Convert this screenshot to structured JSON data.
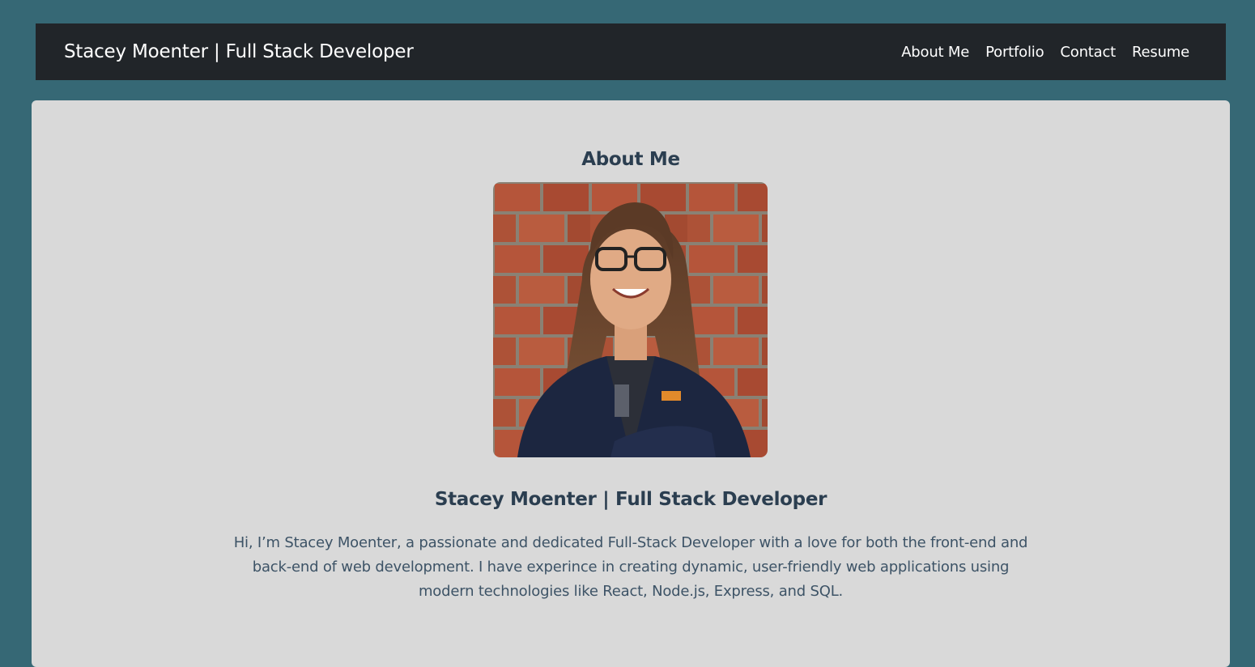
{
  "header": {
    "brand": "Stacey Moenter | Full Stack Developer",
    "nav": [
      {
        "label": "About Me"
      },
      {
        "label": "Portfolio"
      },
      {
        "label": "Contact"
      },
      {
        "label": "Resume"
      }
    ]
  },
  "about": {
    "title": "About Me",
    "name_heading": "Stacey Moenter | Full Stack Developer",
    "bio": "Hi, I’m Stacey Moenter, a passionate and dedicated Full-Stack Developer with a love for both the front-end and back-end of web development. I have experince in creating dynamic, user-friendly web applications using modern technologies like React, Node.js, Express, and SQL."
  },
  "colors": {
    "page_background": "#366875",
    "navbar": "#212529",
    "card": "#d9d9d9",
    "heading_text": "#2b3e50"
  }
}
